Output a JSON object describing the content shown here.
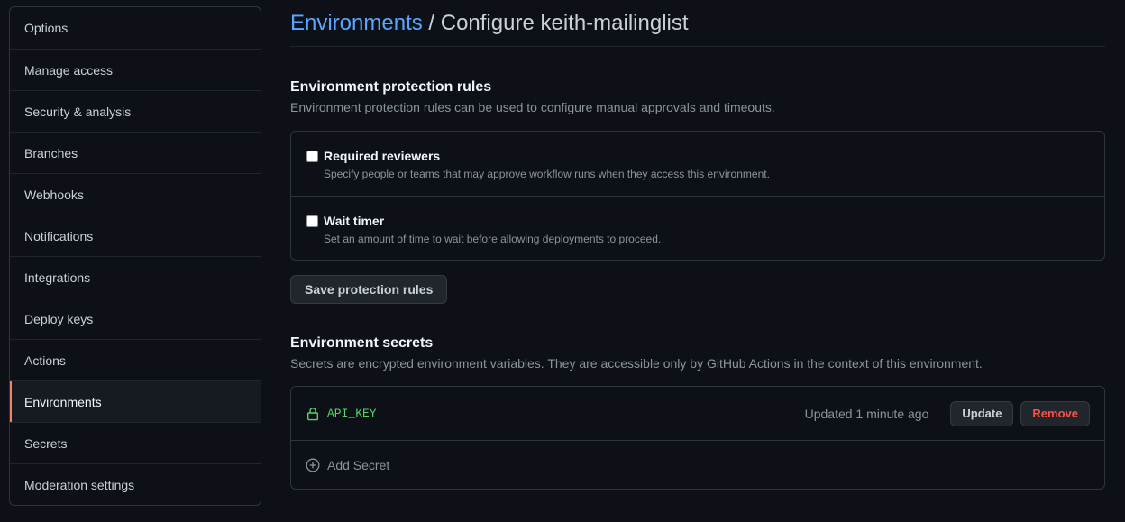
{
  "sidebar": {
    "items": [
      {
        "label": "Options"
      },
      {
        "label": "Manage access"
      },
      {
        "label": "Security & analysis"
      },
      {
        "label": "Branches"
      },
      {
        "label": "Webhooks"
      },
      {
        "label": "Notifications"
      },
      {
        "label": "Integrations"
      },
      {
        "label": "Deploy keys"
      },
      {
        "label": "Actions"
      },
      {
        "label": "Environments"
      },
      {
        "label": "Secrets"
      },
      {
        "label": "Moderation settings"
      }
    ],
    "active": "Environments"
  },
  "header": {
    "breadcrumb_link": "Environments",
    "title": " / Configure keith-mailinglist"
  },
  "protection": {
    "heading": "Environment protection rules",
    "description": "Environment protection rules can be used to configure manual approvals and timeouts.",
    "rules": [
      {
        "title": "Required reviewers",
        "description": "Specify people or teams that may approve workflow runs when they access this environment.",
        "checked": false
      },
      {
        "title": "Wait timer",
        "description": "Set an amount of time to wait before allowing deployments to proceed.",
        "checked": false
      }
    ],
    "save_label": "Save protection rules"
  },
  "secrets": {
    "heading": "Environment secrets",
    "description": "Secrets are encrypted environment variables. They are accessible only by GitHub Actions in the context of this environment.",
    "items": [
      {
        "name": "API_KEY",
        "updated": "Updated 1 minute ago",
        "update_label": "Update",
        "remove_label": "Remove"
      }
    ],
    "add_label": "Add Secret"
  },
  "colors": {
    "background": "#0d1117",
    "link": "#58a6ff",
    "active_indicator": "#f78166",
    "secret_name": "#56d364",
    "danger": "#f85149"
  }
}
